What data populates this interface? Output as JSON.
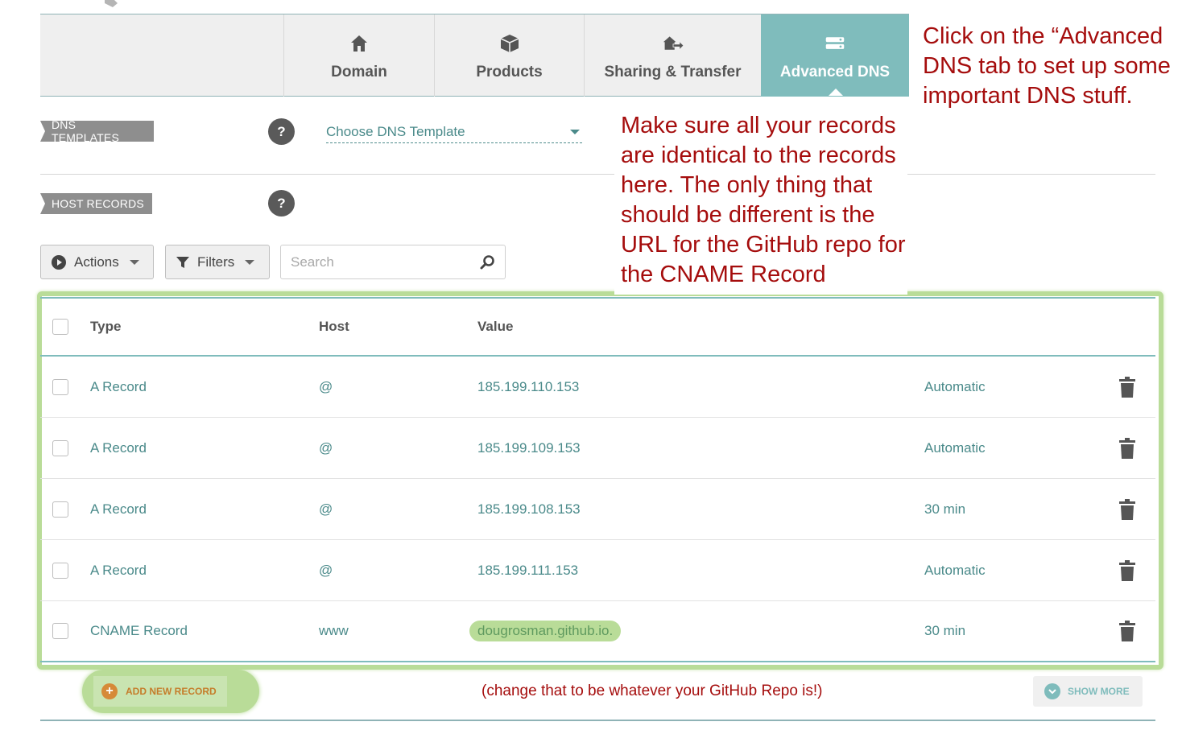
{
  "tabs": [
    {
      "label": "Domain",
      "icon": "home-icon",
      "active": false
    },
    {
      "label": "Products",
      "icon": "box-icon",
      "active": false
    },
    {
      "label": "Sharing & Transfer",
      "icon": "transfer-icon",
      "active": false
    },
    {
      "label": "Advanced DNS",
      "icon": "server-icon",
      "active": true
    }
  ],
  "dns_templates": {
    "label": "DNS TEMPLATES",
    "help": "?",
    "select_value": "Choose DNS Template"
  },
  "host_records": {
    "label": "HOST RECORDS",
    "help": "?"
  },
  "toolbar": {
    "actions_label": "Actions",
    "filters_label": "Filters",
    "search_placeholder": "Search"
  },
  "table": {
    "columns": [
      "Type",
      "Host",
      "Value"
    ],
    "rows": [
      {
        "type": "A Record",
        "host": "@",
        "value": "185.199.110.153",
        "ttl": "Automatic"
      },
      {
        "type": "A Record",
        "host": "@",
        "value": "185.199.109.153",
        "ttl": "Automatic"
      },
      {
        "type": "A Record",
        "host": "@",
        "value": "185.199.108.153",
        "ttl": "30 min"
      },
      {
        "type": "A Record",
        "host": "@",
        "value": "185.199.111.153",
        "ttl": "Automatic"
      },
      {
        "type": "CNAME Record",
        "host": "www",
        "value": "dougrosman.github.io.",
        "ttl": "30 min"
      }
    ]
  },
  "footer": {
    "add_label": "ADD NEW RECORD",
    "show_more_label": "SHOW MORE"
  },
  "annotations": {
    "tab_note": "Click on the “Advanced DNS tab to set up some important DNS stuff.",
    "records_note": "Make sure all your records are identical to the records here. The only thing that should be different is the URL for the GitHub repo for the CNAME Record",
    "repo_note": "(change that to be whatever your GitHub Repo is!)"
  },
  "colors": {
    "accent": "#7fbcbc",
    "highlight": "#b9dc98",
    "annotation": "#a50d0d",
    "add_orange": "#d68a38"
  }
}
